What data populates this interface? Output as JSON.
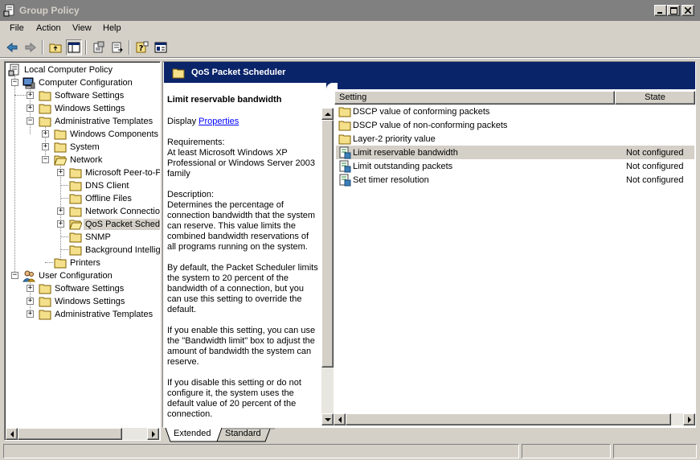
{
  "window": {
    "title": "Group Policy"
  },
  "menu": [
    "File",
    "Action",
    "View",
    "Help"
  ],
  "tree": {
    "items": [
      {
        "label": "Local Computer Policy"
      },
      {
        "label": "Computer Configuration"
      },
      {
        "label": "Software Settings"
      },
      {
        "label": "Windows Settings"
      },
      {
        "label": "Administrative Templates"
      },
      {
        "label": "Windows Components"
      },
      {
        "label": "System"
      },
      {
        "label": "Network"
      },
      {
        "label": "Microsoft Peer-to-P"
      },
      {
        "label": "DNS Client"
      },
      {
        "label": "Offline Files"
      },
      {
        "label": "Network Connectio"
      },
      {
        "label": "QoS Packet Schedu"
      },
      {
        "label": "SNMP"
      },
      {
        "label": "Background Intellig"
      },
      {
        "label": "Printers"
      },
      {
        "label": "User Configuration"
      },
      {
        "label": "Software Settings"
      },
      {
        "label": "Windows Settings"
      },
      {
        "label": "Administrative Templates"
      }
    ]
  },
  "header": {
    "title": "QoS Packet Scheduler"
  },
  "description": {
    "title": "Limit reservable bandwidth",
    "display_prefix": "Display ",
    "display_link": "Properties",
    "requirements": "Requirements:\nAt least Microsoft Windows XP Professional or Windows Server 2003 family",
    "description": "Description:\nDetermines the percentage of connection bandwidth that the system can reserve. This value limits the combined bandwidth reservations of all programs running on the system.",
    "p1": "By default, the Packet Scheduler limits the system to 20 percent of the bandwidth of a connection, but you can use this setting to override the default.",
    "p2": "If you enable this setting, you can use the \"Bandwidth limit\" box to adjust the amount of bandwidth the system can reserve.",
    "p3": "If you disable this setting or do not configure it, the system uses the default value of 20 percent of the connection."
  },
  "list": {
    "columns": {
      "setting": "Setting",
      "state": "State"
    },
    "rows": [
      {
        "setting": "DSCP value of conforming packets",
        "state": "",
        "kind": "folder"
      },
      {
        "setting": "DSCP value of non-conforming packets",
        "state": "",
        "kind": "folder"
      },
      {
        "setting": "Layer-2 priority value",
        "state": "",
        "kind": "folder"
      },
      {
        "setting": "Limit reservable bandwidth",
        "state": "Not configured",
        "kind": "policy"
      },
      {
        "setting": "Limit outstanding packets",
        "state": "Not configured",
        "kind": "policy"
      },
      {
        "setting": "Set timer resolution",
        "state": "Not configured",
        "kind": "policy"
      }
    ]
  },
  "tabs": {
    "extended": "Extended",
    "standard": "Standard"
  }
}
